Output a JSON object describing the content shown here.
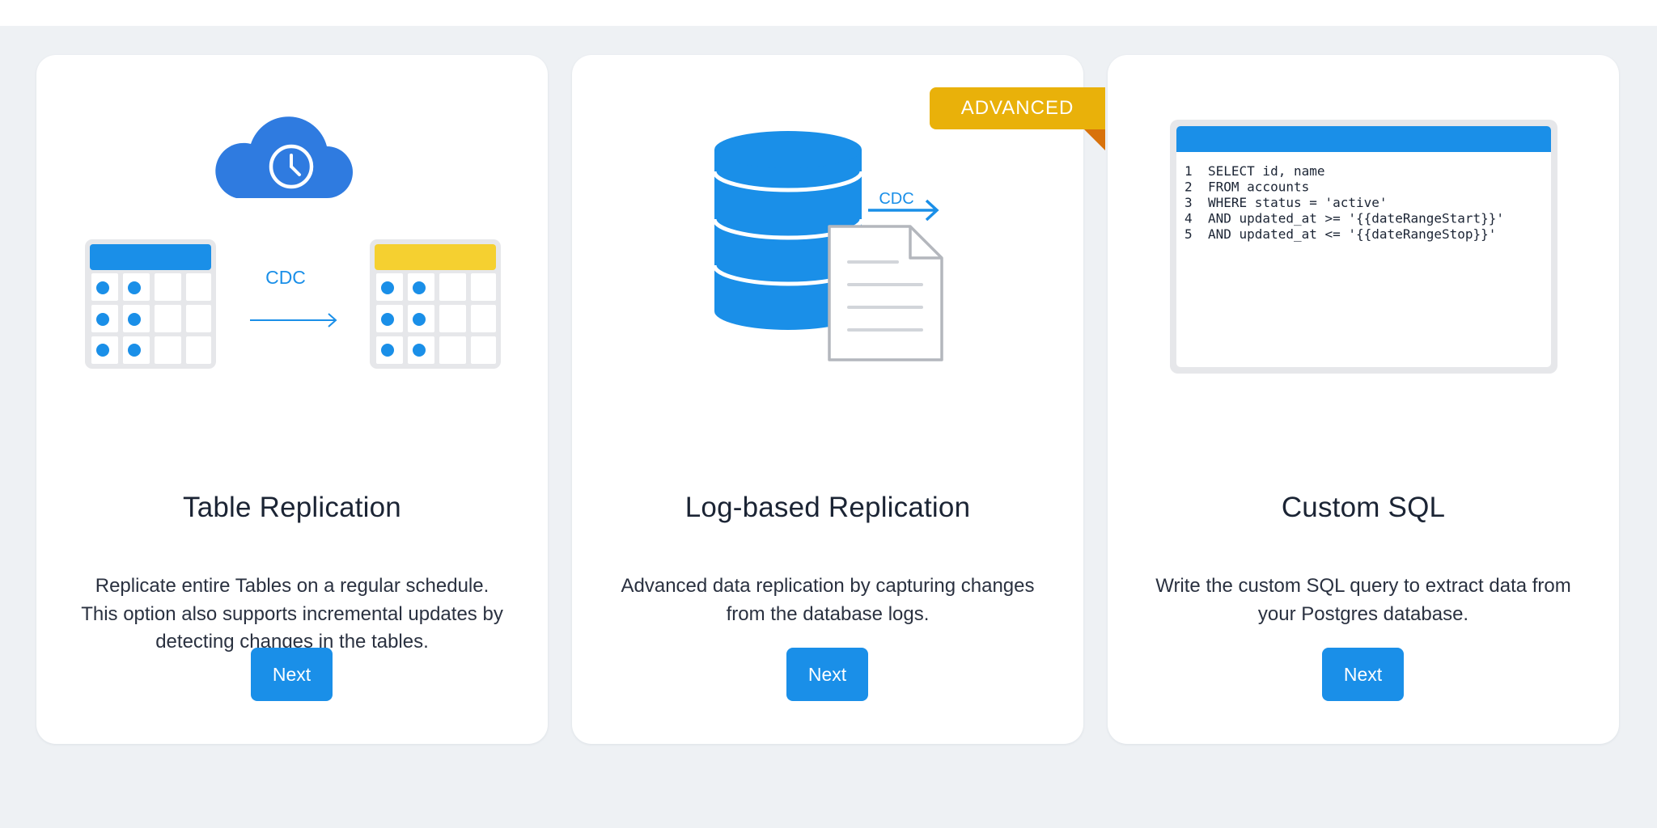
{
  "colors": {
    "accent": "#1a8fe8",
    "highlight": "#f5d030",
    "ribbon": "#e9b10a",
    "ribbon_fold": "#d8720b",
    "cloud": "#2f7be0",
    "background": "#eef1f4",
    "text": "#1b2434"
  },
  "cards": [
    {
      "title": "Table Replication",
      "description": "Replicate entire Tables on a regular schedule. This option also supports incremental updates by detecting changes in the tables.",
      "button": "Next",
      "illustration": {
        "icons": [
          "cloud-clock-icon",
          "source-table-icon",
          "arrow-right-icon",
          "destination-table-icon"
        ],
        "arrow_label": "CDC"
      }
    },
    {
      "title": "Log-based Replication",
      "description": "Advanced data replication by capturing changes from the database logs.",
      "button": "Next",
      "badge": "ADVANCED",
      "illustration": {
        "icons": [
          "database-icon",
          "arrow-right-icon",
          "document-icon"
        ],
        "arrow_label": "CDC"
      }
    },
    {
      "title": "Custom SQL",
      "description": "Write the custom SQL query to extract data from your Postgres database.",
      "button": "Next",
      "illustration": {
        "icons": [
          "sql-editor-icon"
        ],
        "code_lines": [
          {
            "num": "1",
            "code": "SELECT id, name"
          },
          {
            "num": "2",
            "code": "FROM accounts"
          },
          {
            "num": "3",
            "code": "WHERE status = 'active'"
          },
          {
            "num": "4",
            "code": "AND updated_at >= '{{dateRangeStart}}'"
          },
          {
            "num": "5",
            "code": "AND updated_at <= '{{dateRangeStop}}'"
          }
        ]
      }
    }
  ]
}
